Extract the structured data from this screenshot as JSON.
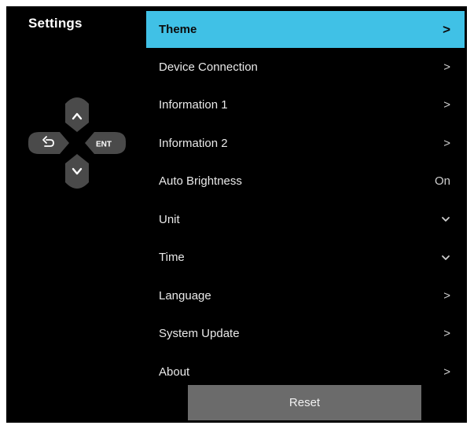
{
  "header": {
    "title": "Settings"
  },
  "dpad": {
    "enter_label": "ENT"
  },
  "menu": {
    "items": [
      {
        "label": "Theme",
        "right": ">",
        "kind": "chevron-right",
        "active": true
      },
      {
        "label": "Device Connection",
        "right": ">",
        "kind": "chevron-right"
      },
      {
        "label": "Information 1",
        "right": ">",
        "kind": "chevron-right"
      },
      {
        "label": "Information 2",
        "right": ">",
        "kind": "chevron-right"
      },
      {
        "label": "Auto Brightness",
        "right": "On",
        "kind": "value"
      },
      {
        "label": "Unit",
        "kind": "chevron-down"
      },
      {
        "label": "Time",
        "kind": "chevron-down"
      },
      {
        "label": "Language",
        "right": ">",
        "kind": "chevron-right"
      },
      {
        "label": "System Update",
        "right": ">",
        "kind": "chevron-right"
      },
      {
        "label": "About",
        "right": ">",
        "kind": "chevron-right"
      }
    ]
  },
  "footer": {
    "reset_label": "Reset"
  },
  "colors": {
    "accent": "#40c1e6",
    "background": "#000000",
    "button": "#6b6b6b",
    "dpad": "#4a4a4a"
  }
}
